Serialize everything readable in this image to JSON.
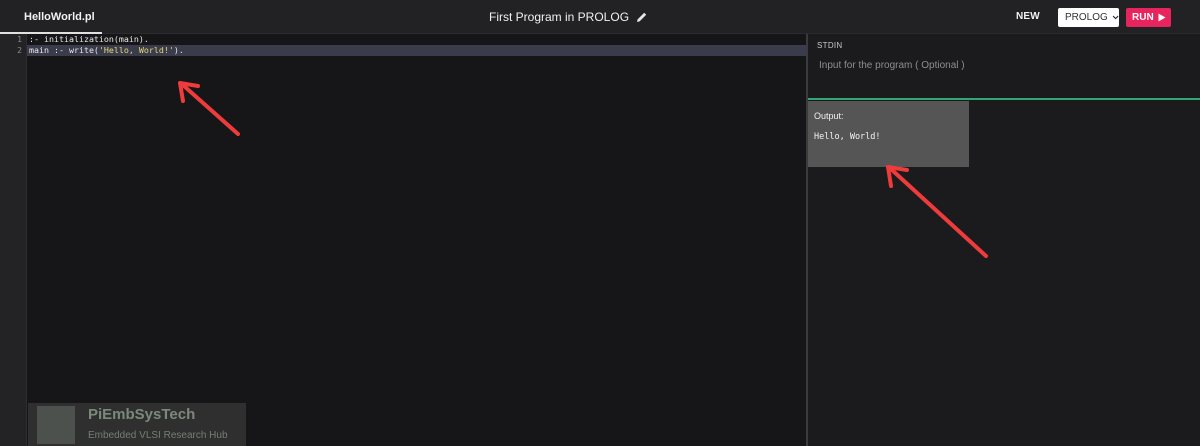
{
  "topbar": {
    "file_tab": "HelloWorld.pl",
    "title": "First Program in PROLOG",
    "new_label": "NEW",
    "language": "PROLOG",
    "run_label": "RUN",
    "run_color": "#e8245f"
  },
  "editor": {
    "lines": [
      {
        "number": "1",
        "text": ":- initialization(main)."
      },
      {
        "number": "2",
        "prefix": "main :- write(",
        "string": "'Hello, World!'",
        "suffix": ")."
      }
    ]
  },
  "stdin": {
    "label": "STDIN",
    "placeholder": "Input for the program ( Optional )"
  },
  "output": {
    "label": "Output:",
    "text": "Hello, World!"
  },
  "watermark": {
    "name": "PiEmbSysTech",
    "subtitle": "Embedded VLSI Research Hub"
  },
  "annotation_color": "#ee3b3b"
}
